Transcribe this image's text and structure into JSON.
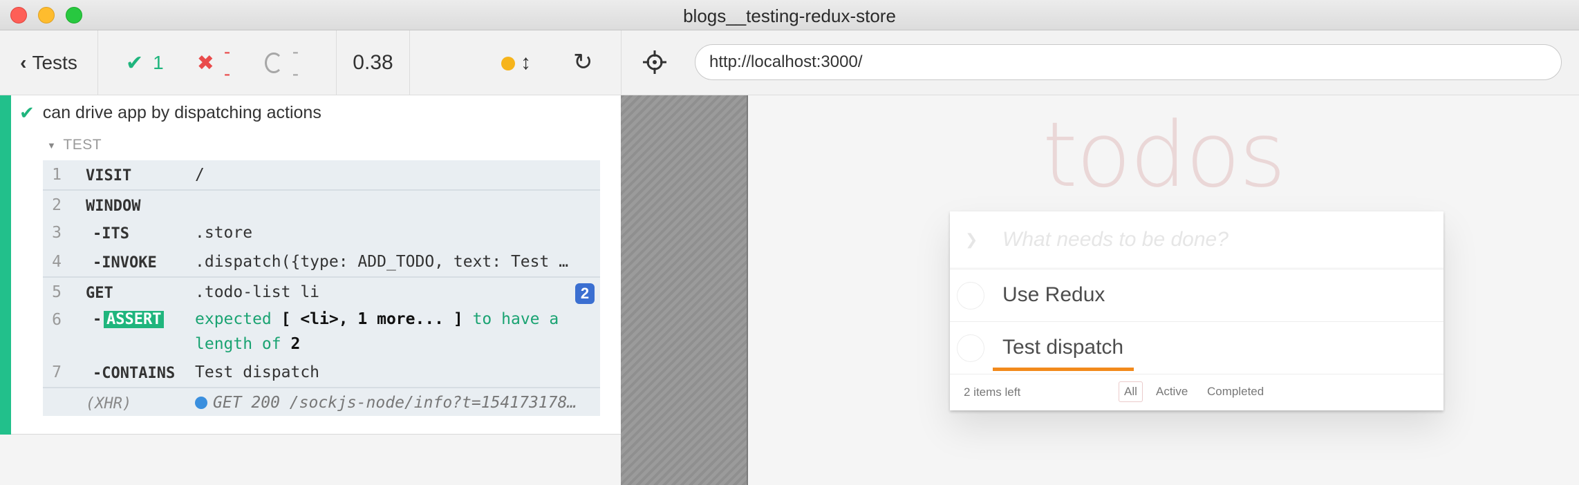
{
  "window": {
    "title": "blogs__testing-redux-store"
  },
  "reporter": {
    "tests_label": "Tests",
    "stats": {
      "passed": "1",
      "failed": "--",
      "pending": "--"
    },
    "duration": "0.38"
  },
  "test": {
    "title": "can drive app by dispatching actions",
    "section_label": "TEST",
    "commands": [
      {
        "num": "1",
        "name": "VISIT",
        "message": "/"
      },
      {
        "num": "2",
        "name": "WINDOW",
        "message": ""
      },
      {
        "num": "3",
        "name": "-ITS",
        "message": ".store"
      },
      {
        "num": "4",
        "name": "-INVOKE",
        "message": ".dispatch({type: ADD_TODO, text: Test …"
      },
      {
        "num": "5",
        "name": "GET",
        "message": ".todo-list li",
        "badge": "2"
      },
      {
        "num": "6",
        "prefix": "-",
        "name": "ASSERT",
        "message_pre": "expected ",
        "message_bold1": "[ <li>, 1 more... ]",
        "message_mid": " to have a length of ",
        "message_bold2": "2"
      },
      {
        "num": "7",
        "name": "-CONTAINS",
        "message": "Test dispatch"
      },
      {
        "num": "",
        "name": "(XHR)",
        "message": "GET 200 /sockjs-node/info?t=154173178…"
      }
    ]
  },
  "aut": {
    "url": "http://localhost:3000/",
    "app_title": "todos",
    "new_todo_placeholder": "What needs to be done?",
    "todos": [
      "Use Redux",
      "Test dispatch"
    ],
    "items_left": "2 items left",
    "filters": [
      "All",
      "Active",
      "Completed"
    ]
  },
  "colors": {
    "pass": "#1fb57d",
    "fail": "#e94b4b",
    "highlight": "#f28a1c",
    "badge": "#3b6fd1"
  }
}
